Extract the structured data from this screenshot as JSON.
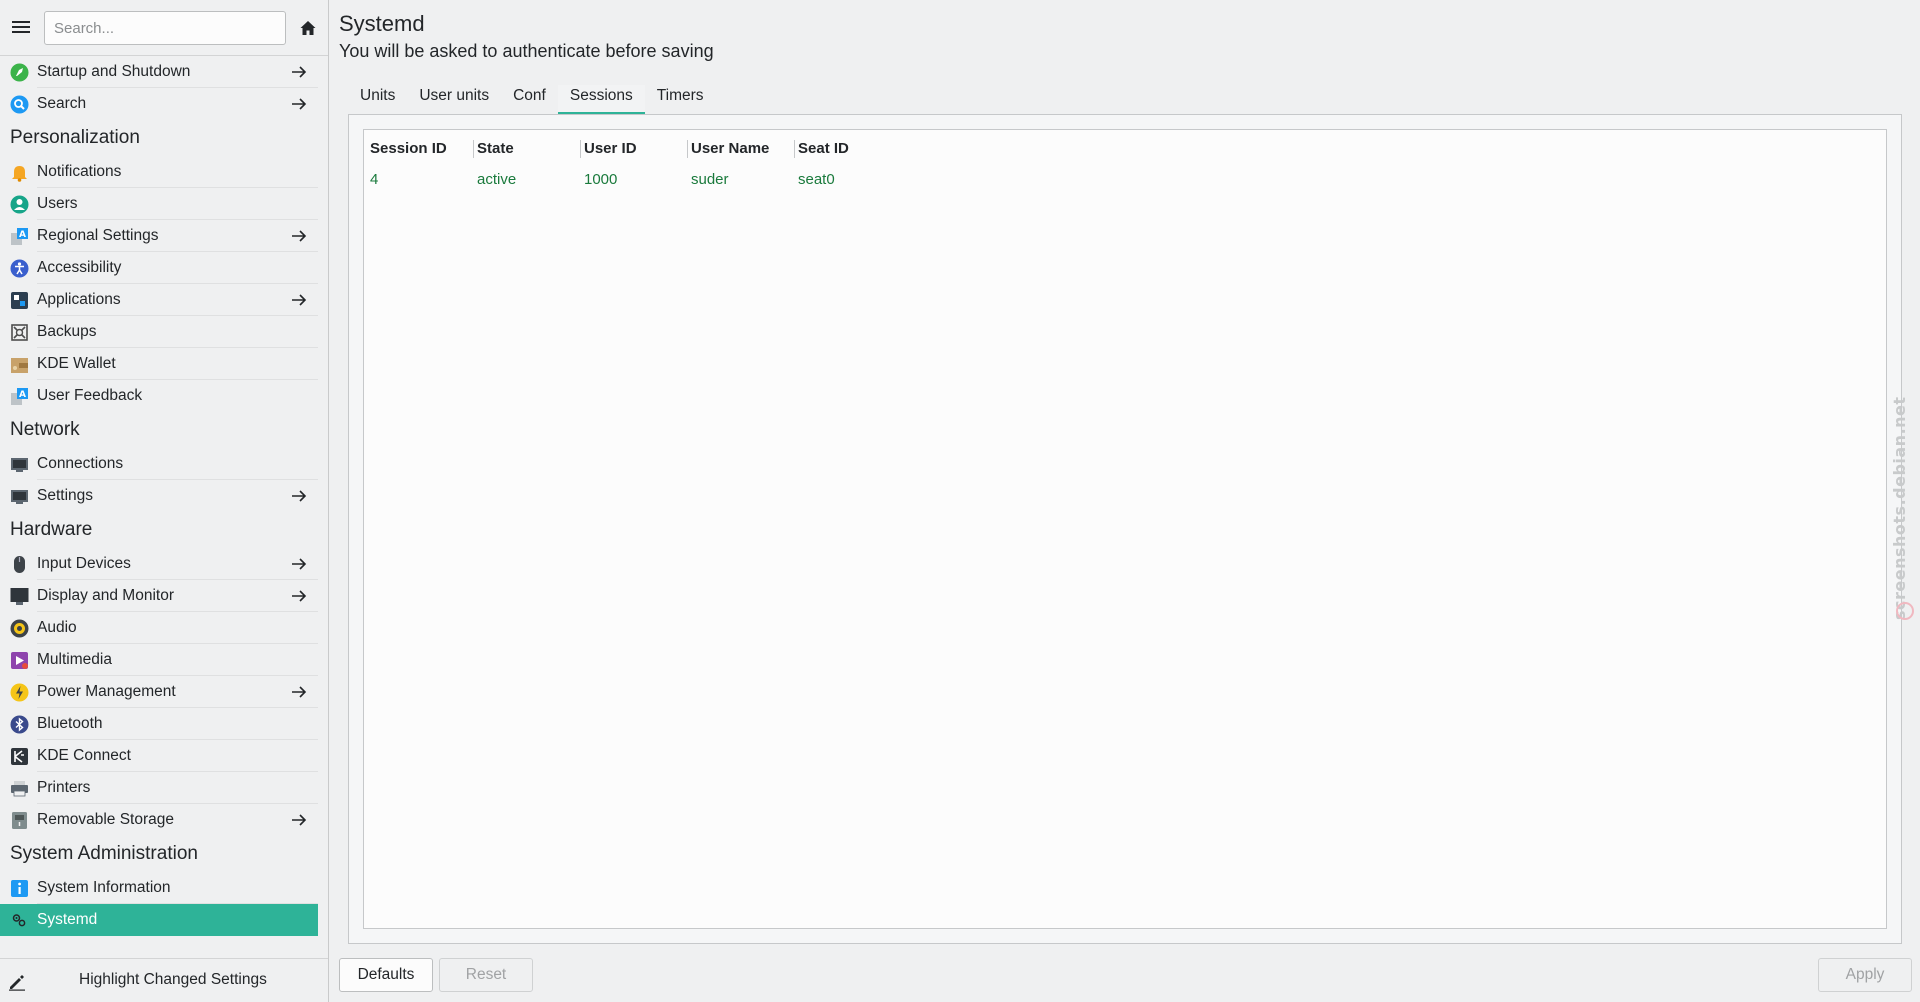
{
  "sidebar": {
    "search_placeholder": "Search...",
    "sections": [
      {
        "header": "",
        "items": [
          {
            "label": "Startup and Shutdown",
            "icon": "rocket-icon",
            "arrow": true
          },
          {
            "label": "Search",
            "icon": "magnifier-icon",
            "arrow": true
          }
        ]
      },
      {
        "header": "Personalization",
        "items": [
          {
            "label": "Notifications",
            "icon": "bell-icon",
            "arrow": false
          },
          {
            "label": "Users",
            "icon": "user-icon",
            "arrow": false
          },
          {
            "label": "Regional Settings",
            "icon": "language-icon",
            "arrow": true
          },
          {
            "label": "Accessibility",
            "icon": "accessibility-icon",
            "arrow": false
          },
          {
            "label": "Applications",
            "icon": "applications-icon",
            "arrow": true
          },
          {
            "label": "Backups",
            "icon": "backups-icon",
            "arrow": false
          },
          {
            "label": "KDE Wallet",
            "icon": "wallet-icon",
            "arrow": false
          },
          {
            "label": "User Feedback",
            "icon": "feedback-icon",
            "arrow": false
          }
        ]
      },
      {
        "header": "Network",
        "items": [
          {
            "label": "Connections",
            "icon": "monitor-network-icon",
            "arrow": false
          },
          {
            "label": "Settings",
            "icon": "monitor-settings-icon",
            "arrow": true
          }
        ]
      },
      {
        "header": "Hardware",
        "items": [
          {
            "label": "Input Devices",
            "icon": "mouse-icon",
            "arrow": true
          },
          {
            "label": "Display and Monitor",
            "icon": "display-icon",
            "arrow": true
          },
          {
            "label": "Audio",
            "icon": "speaker-icon",
            "arrow": false
          },
          {
            "label": "Multimedia",
            "icon": "multimedia-icon",
            "arrow": false
          },
          {
            "label": "Power Management",
            "icon": "power-icon",
            "arrow": true
          },
          {
            "label": "Bluetooth",
            "icon": "bluetooth-icon",
            "arrow": false
          },
          {
            "label": "KDE Connect",
            "icon": "kdeconnect-icon",
            "arrow": false
          },
          {
            "label": "Printers",
            "icon": "printer-icon",
            "arrow": false
          },
          {
            "label": "Removable Storage",
            "icon": "usb-storage-icon",
            "arrow": true
          }
        ]
      },
      {
        "header": "System Administration",
        "items": [
          {
            "label": "System Information",
            "icon": "info-icon",
            "arrow": false
          },
          {
            "label": "Systemd",
            "icon": "systemd-icon",
            "arrow": false,
            "active": true
          }
        ]
      }
    ],
    "highlight_label": "Highlight Changed Settings"
  },
  "main": {
    "title": "Systemd",
    "subtitle": "You will be asked to authenticate before saving",
    "tabs": [
      {
        "label": "Units",
        "active": false
      },
      {
        "label": "User units",
        "active": false
      },
      {
        "label": "Conf",
        "active": false
      },
      {
        "label": "Sessions",
        "active": true
      },
      {
        "label": "Timers",
        "active": false
      }
    ],
    "table": {
      "columns": [
        "Session ID",
        "State",
        "User ID",
        "User Name",
        "Seat ID"
      ],
      "rows": [
        [
          "4",
          "active",
          "1000",
          "suder",
          "seat0"
        ]
      ]
    },
    "buttons": {
      "defaults": "Defaults",
      "reset": "Reset",
      "apply": "Apply"
    }
  },
  "colors": {
    "accent": "#2eb398",
    "active_text": "#1a7a3c",
    "window_bg": "#eff0f1"
  },
  "watermark": "screenshots.debian.net"
}
